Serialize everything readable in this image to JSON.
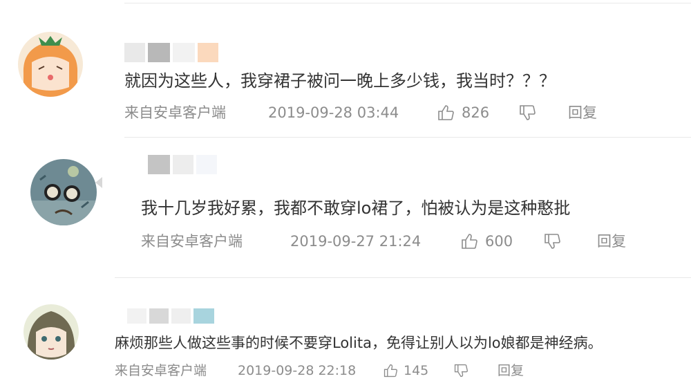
{
  "comments": [
    {
      "text": "就因为这些人，我穿裙子被问一晚上多少钱，我当时？？？",
      "source": "来自安卓客户端",
      "time": "2019-09-28 03:44",
      "likes": "826",
      "reply": "回复"
    },
    {
      "text": "我十几岁我好累，我都不敢穿lo裙了，怕被认为是这种憨批",
      "source": "来自安卓客户端",
      "time": "2019-09-27 21:24",
      "likes": "600",
      "reply": "回复"
    },
    {
      "text": "麻烦那些人做这些事的时候不要穿Lolita，免得让别人以为lo娘都是神经病。",
      "source": "来自安卓客户端",
      "time": "2019-09-28 22:18",
      "likes": "145",
      "reply": "回复"
    }
  ],
  "colors": {
    "text": "#333333",
    "meta": "#8c8c8c",
    "divider": "#e8e8e8",
    "blur_gray": "#bdbdbd",
    "blur_peach": "#fbd9bd",
    "blur_blue": "#a8d4de"
  }
}
